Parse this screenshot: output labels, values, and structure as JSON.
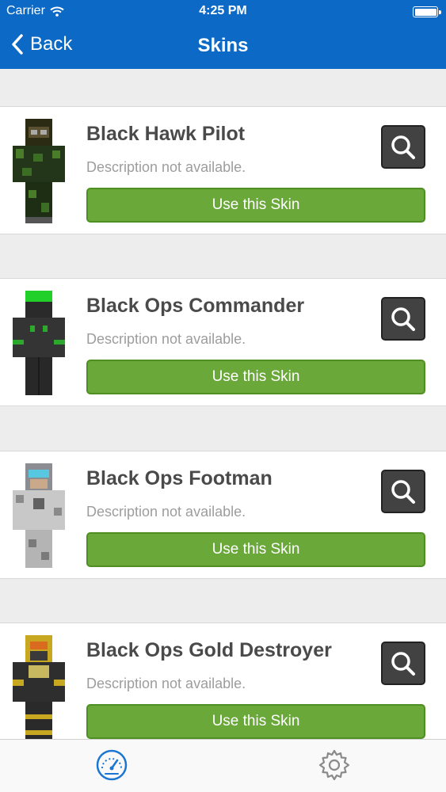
{
  "status_bar": {
    "carrier": "Carrier",
    "time": "4:25 PM"
  },
  "nav": {
    "back_label": "Back",
    "title": "Skins"
  },
  "skins": [
    {
      "name": "Black Hawk Pilot",
      "description": "Description not available.",
      "use_label": "Use this Skin"
    },
    {
      "name": "Black Ops Commander",
      "description": "Description not available.",
      "use_label": "Use this Skin"
    },
    {
      "name": "Black Ops Footman",
      "description": "Description not available.",
      "use_label": "Use this Skin"
    },
    {
      "name": "Black Ops Gold Destroyer",
      "description": "Description not available.",
      "use_label": "Use this Skin"
    }
  ],
  "tab_bar": {
    "items": [
      {
        "icon": "speedometer-icon",
        "active": true
      },
      {
        "icon": "gear-icon",
        "active": false
      }
    ]
  },
  "colors": {
    "nav_bar": "#0c69c6",
    "use_button": "#6aa83a",
    "active_tab": "#1a76d2"
  }
}
